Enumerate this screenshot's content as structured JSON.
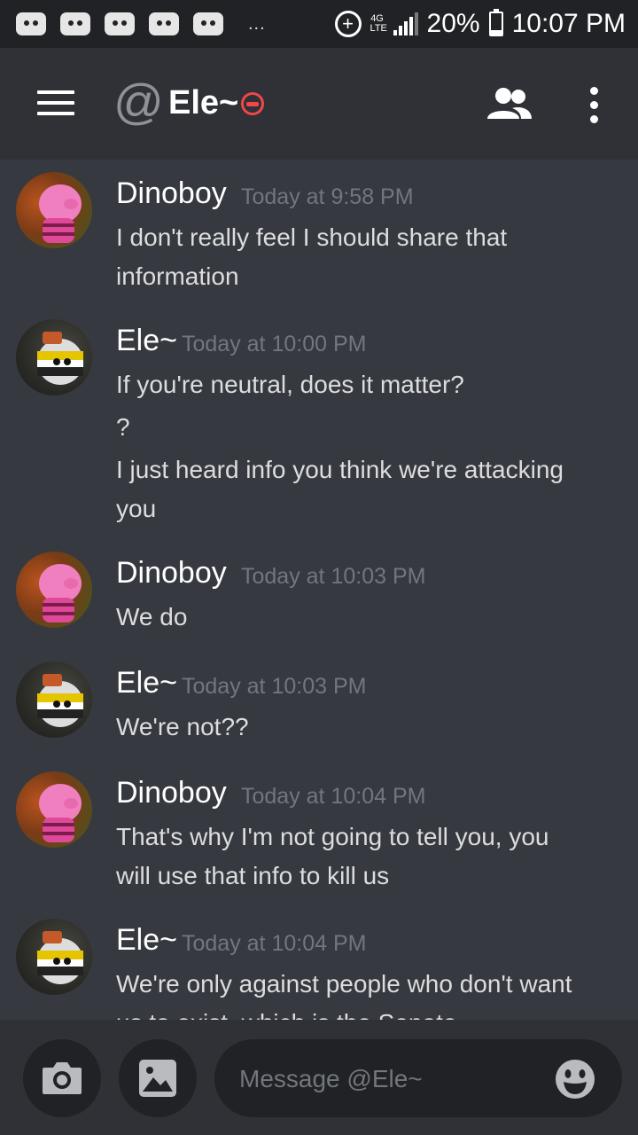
{
  "status_bar": {
    "battery": "20%",
    "time": "10:07 PM",
    "network": "4G LTE",
    "overflow": "..."
  },
  "header": {
    "channel_prefix": "@",
    "channel_name": "Ele~",
    "status": "do-not-disturb",
    "icons": [
      "hamburger-menu-icon",
      "members-icon",
      "more-vertical-icon"
    ]
  },
  "messages": [
    {
      "author": "Dinoboy",
      "timestamp": "Today at 9:58 PM",
      "avatar": "pig-avatar",
      "lines": [
        "I don't really feel I should share that",
        "information"
      ]
    },
    {
      "author": "Ele~",
      "timestamp": "Today at 10:00 PM",
      "avatar": "countryball-avatar",
      "lines": [
        "If you're neutral, does it matter?",
        "?",
        "I just heard info you think we're attacking",
        "you"
      ]
    },
    {
      "author": "Dinoboy",
      "timestamp": "Today at 10:03 PM",
      "avatar": "pig-avatar",
      "lines": [
        "We do"
      ]
    },
    {
      "author": "Ele~",
      "timestamp": "Today at 10:03 PM",
      "avatar": "countryball-avatar",
      "lines": [
        "We're not??"
      ]
    },
    {
      "author": "Dinoboy",
      "timestamp": "Today at 10:04 PM",
      "avatar": "pig-avatar",
      "lines": [
        "That's why I'm not going to tell you, you",
        "will use that info to kill us"
      ]
    },
    {
      "author": "Ele~",
      "timestamp": "Today at 10:04 PM",
      "avatar": "countryball-avatar",
      "lines": [
        "We're only against people who don't want",
        "us to exist, which is the Senate"
      ]
    }
  ],
  "input": {
    "placeholder": "Message @Ele~",
    "value": ""
  },
  "colors": {
    "background": "#36393f",
    "header": "#2f3136",
    "statusbar": "#202225",
    "timestamp": "#72767d",
    "dnd": "#f04747"
  }
}
